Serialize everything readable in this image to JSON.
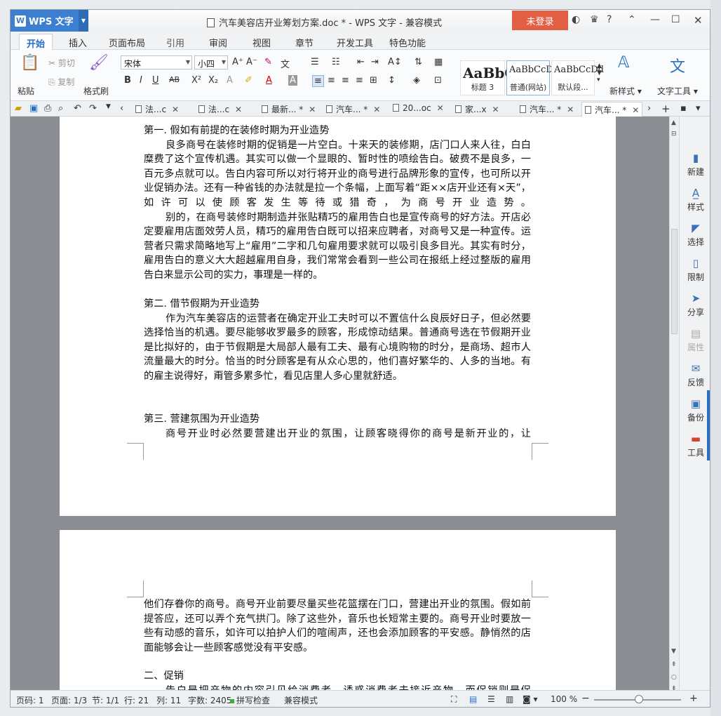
{
  "app": {
    "name": "WPS 文字",
    "logo": "W",
    "title": "汽车美容店开业筹划方案.doc * - WPS 文字 - 兼容模式",
    "login": "未登录"
  },
  "window_controls": {
    "skin": "shirt-icon",
    "help": "?",
    "min": "—",
    "max": "☐",
    "close": "✕"
  },
  "menu": {
    "tabs": [
      "开始",
      "插入",
      "页面布局",
      "引用",
      "审阅",
      "视图",
      "章节",
      "开发工具",
      "特色功能"
    ],
    "active": 0
  },
  "ribbon": {
    "paste": "粘贴",
    "cut": "剪切",
    "copy": "复制",
    "format_painter": "格式刷",
    "font": "宋体",
    "size": "小四",
    "bold": "B",
    "italic": "I",
    "underline": "U",
    "strike": "AB",
    "styles": [
      {
        "preview": "AaBbC",
        "name": "标题 3"
      },
      {
        "preview": "AaBbCcDd",
        "name": "普通(网站)"
      },
      {
        "preview": "AaBbCcDd",
        "name": "默认段..."
      }
    ],
    "new_style": "新样式",
    "text_tools": "文字工具"
  },
  "doc_tabs": [
    "法...c",
    "法...c",
    "最新... *",
    "汽车... *",
    "20...oc",
    "家...x",
    "汽车... *",
    "汽车... *"
  ],
  "doc_tabs_active": 7,
  "document": {
    "h1": "第一. 假如有前提的在装修时期为开业造势",
    "p1": "良多商号在装修时期的促销是一片空白。十来天的装修期，店门口人来人往，白白糜费了这个宣传机遇。其实可以做一个显眼的、暂时性的喷绘告白。破费不是良多，一百元多点就可以。告白内容可所以对行将开业的商号进行品牌形象的宣传，也可所以开业促销办法。还有一种省钱的办法就是拉一个条幅，上面写着“距××店开业还有×天”，如许可以使顾客发生等待或猎奇，为商号开业造势。",
    "p2": "别的，在商号装修时期制造并张贴精巧的雇用告白也是宣传商号的好方法。开店必定要雇用店面效劳人员，精巧的雇用告白既可以招来应聘者，对商号又是一种宣传。运营者只需求简略地写上“雇用”二字和几句雇用要求就可以吸引良多目光。其实有时分，雇用告白的意义大大超越雇用自身，我们常常会看到一些公司在报纸上经过整版的雇用告白来显示公司的实力，事理是一样的。",
    "h2": "第二. 借节假期为开业造势",
    "p3": "作为汽车美容店的运营者在确定开业工夫时可以不置信什么良辰好日子，但必然要选择恰当的机遇。要尽能够收罗最多的顾客，形成惊动结果。普通商号选在节假期开业是比拟好的，由于节假期是大局部人最有工夫、最有心境购物的时分，是商场、超市人流量最大的时分。恰当的时分顾客是有从众心思的，他们喜好繁华的、人多的当地。有的雇主说得好，甭管多累多忙，看见店里人多心里就舒适。",
    "h3": "第三. 营建氛围为开业造势",
    "p4a": "商号开业时必然要营建出开业的氛围，让顾客晓得你的商号是新开业的，让",
    "p4b": "他们存眷你的商号。商号开业前要尽量买些花篮摆在门口，营建出开业的氛围。假如前提答应，还可以弄个充气拱门。除了这些外，音乐也长短常主要的。商号开业时要放一些有动感的音乐，如许可以拍护人们的喧闹声，还也会添加顾客的平安感。静悄然的店面能够会让一些顾客感觉没有平安感。",
    "h4": "二、促销",
    "p5": "告白是把产物的内容引见给消费者，诱惑消费者去接近产物，而促销则是促"
  },
  "right_panel": [
    "新建",
    "样式",
    "选择",
    "限制",
    "分享",
    "属性",
    "反馈",
    "备份",
    "工具"
  ],
  "status": {
    "page": "页码: 1",
    "pages": "页面: 1/3",
    "section": "节: 1/1",
    "row": "行: 21",
    "col": "列: 11",
    "words": "字数: 2405",
    "spell": "拼写检查",
    "compat": "兼容模式",
    "zoom": "100 %"
  }
}
